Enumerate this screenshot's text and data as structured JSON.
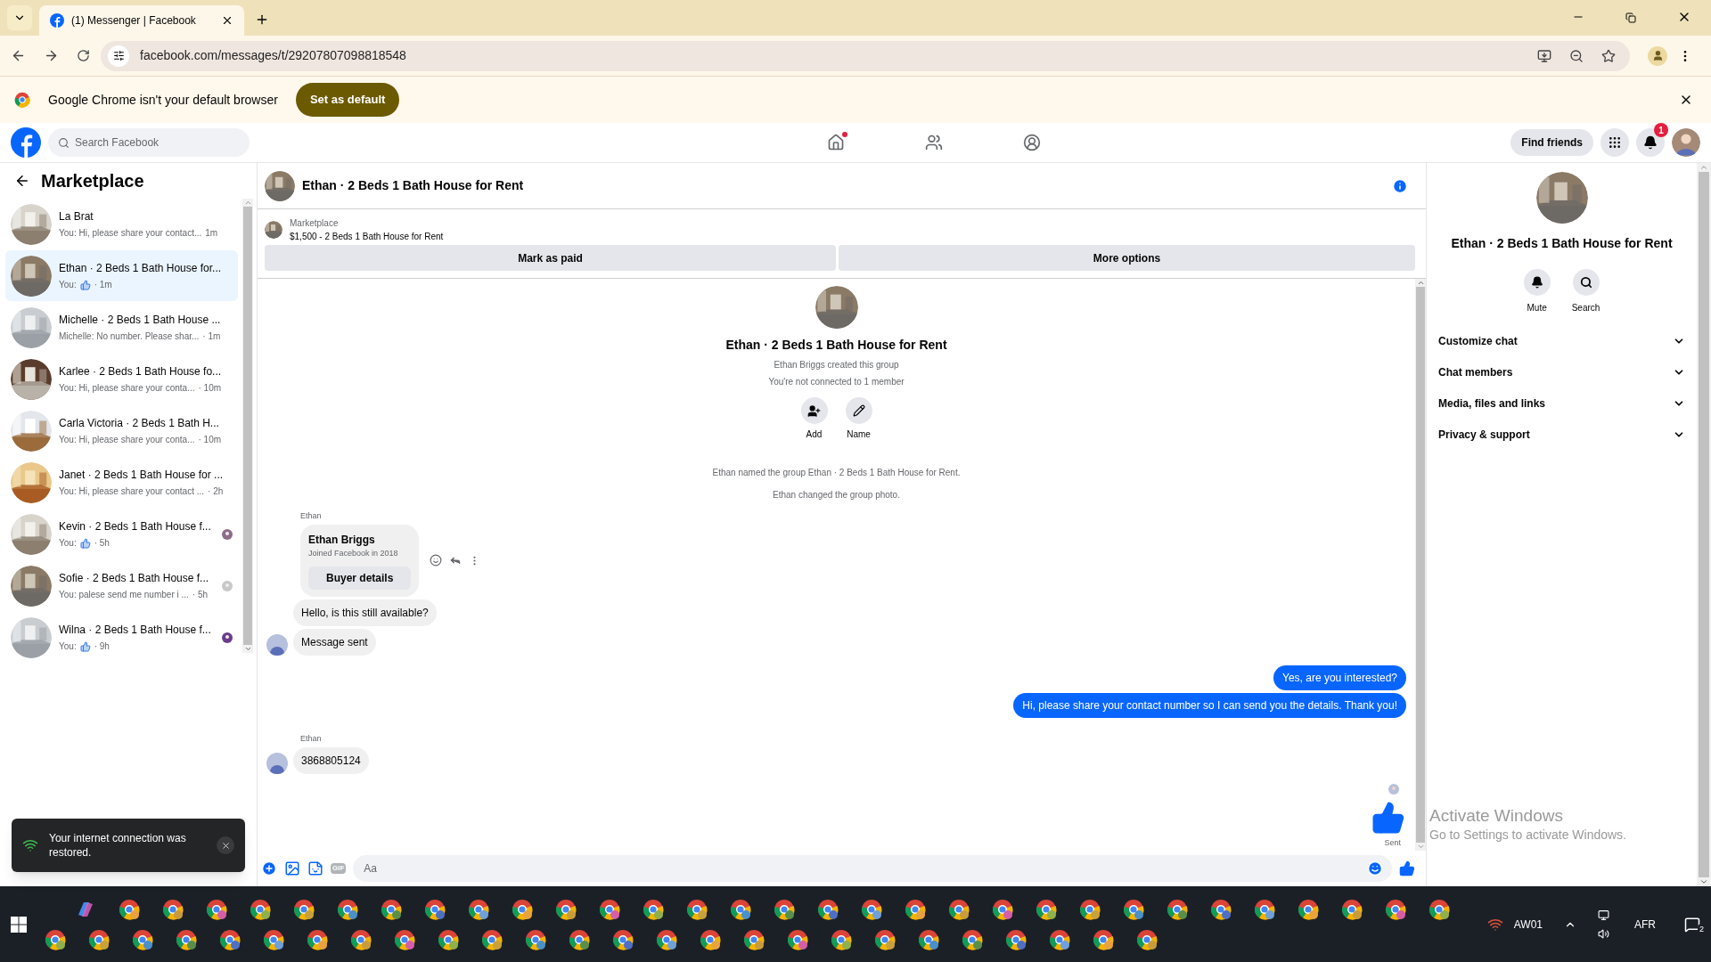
{
  "browser": {
    "tab_title": "(1) Messenger | Facebook",
    "url": "facebook.com/messages/t/29207807098818548",
    "infobar": {
      "text": "Google Chrome isn't your default browser",
      "button": "Set as default"
    }
  },
  "topnav": {
    "search_placeholder": "Search Facebook",
    "find_friends": "Find friends",
    "notification_count": "1",
    "home_dot": true
  },
  "sidebar": {
    "title": "Marketplace",
    "conversations": [
      {
        "name": "La Brat",
        "preview": "You: Hi, please share your contact...",
        "time": "1m",
        "kind": "text",
        "selected": false,
        "seen": false
      },
      {
        "name": "Ethan · 2 Beds 1 Bath House for...",
        "preview": "You:",
        "time": "· 1m",
        "kind": "like",
        "selected": true,
        "seen": false
      },
      {
        "name": "Michelle · 2 Beds 1 Bath House ...",
        "preview": "Michelle: No number. Please shar...",
        "time": "· 1m",
        "kind": "text",
        "selected": false,
        "seen": false
      },
      {
        "name": "Karlee · 2 Beds 1 Bath House fo...",
        "preview": "You: Hi, please share your conta...",
        "time": "· 10m",
        "kind": "text",
        "selected": false,
        "seen": false
      },
      {
        "name": "Carla Victoria · 2 Beds 1 Bath H...",
        "preview": "You: Hi, please share your conta...",
        "time": "· 10m",
        "kind": "text",
        "selected": false,
        "seen": false
      },
      {
        "name": "Janet · 2 Beds 1 Bath House for ...",
        "preview": "You: Hi, please share your contact ...",
        "time": "· 2h",
        "kind": "text",
        "selected": false,
        "seen": false
      },
      {
        "name": "Kevin · 2 Beds 1 Bath House f...",
        "preview": "You:",
        "time": "· 5h",
        "kind": "like",
        "selected": false,
        "seen": true
      },
      {
        "name": "Sofie · 2 Beds 1 Bath House f...",
        "preview": "You: palese send me number i ...",
        "time": "· 5h",
        "kind": "text",
        "selected": false,
        "seen": true
      },
      {
        "name": "Wilna · 2 Beds 1 Bath House f...",
        "preview": "You:",
        "time": "· 9h",
        "kind": "like",
        "selected": false,
        "seen": true
      }
    ]
  },
  "toast": {
    "text": "Your internet connection was restored."
  },
  "chat": {
    "title": "Ethan · 2 Beds 1 Bath House for Rent",
    "listing": {
      "label": "Marketplace",
      "price_line": "$1,500 - 2 Beds 1 Bath House for Rent"
    },
    "buttons": [
      "Mark as paid",
      "More options"
    ],
    "intro": {
      "title": "Ethan · 2 Beds 1 Bath House for Rent",
      "lines": [
        "Ethan Briggs created this group",
        "You're not connected to 1 member"
      ],
      "actions": [
        {
          "kind": "add",
          "label": "Add"
        },
        {
          "kind": "name",
          "label": "Name"
        }
      ]
    },
    "events": [
      "Ethan named the group Ethan · 2 Beds 1 Bath House for Rent.",
      "Ethan changed the group photo."
    ],
    "messages": [
      {
        "kind": "card",
        "sender": "Ethan",
        "title": "Ethan Briggs",
        "subtitle": "Joined Facebook in 2018",
        "button": "Buyer details"
      },
      {
        "kind": "incoming",
        "text": "Hello, is this still available?",
        "avatar": false
      },
      {
        "kind": "incoming",
        "text": "Message sent",
        "avatar": true
      },
      {
        "kind": "outgoing",
        "text": "Yes, are you interested?"
      },
      {
        "kind": "outgoing",
        "text": "Hi, please share your contact number so I can send you the details. Thank you!"
      },
      {
        "kind": "incoming",
        "sender": "Ethan",
        "text": "3868805124",
        "avatar": true
      },
      {
        "kind": "like",
        "status": "Sent"
      }
    ],
    "composer": {
      "placeholder": "Aa",
      "gif_label": "GIF"
    }
  },
  "details": {
    "title": "Ethan · 2 Beds 1 Bath House for Rent",
    "actions": [
      {
        "kind": "mute",
        "label": "Mute"
      },
      {
        "kind": "search",
        "label": "Search"
      }
    ],
    "sections": [
      {
        "label": "Customize chat",
        "expanded": false
      },
      {
        "label": "Chat members",
        "expanded": false
      },
      {
        "label": "Media, files and links",
        "expanded": false
      },
      {
        "label": "Privacy & support",
        "expanded": false
      }
    ]
  },
  "os": {
    "activation": {
      "title": "Activate Windows",
      "subtitle": "Go to Settings to activate Windows."
    },
    "network_label": "AW01",
    "language": "AFR",
    "notification_count": "2"
  }
}
